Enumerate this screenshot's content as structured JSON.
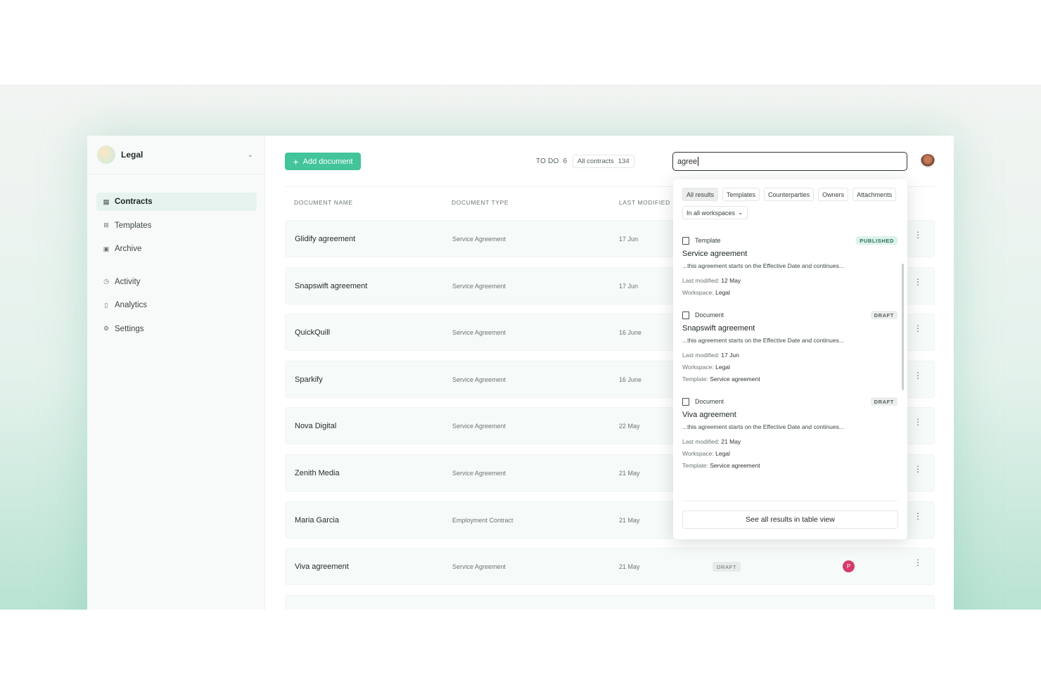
{
  "workspace": {
    "name": "Legal"
  },
  "nav": {
    "items": [
      {
        "label": "Contracts",
        "icon": "document-icon",
        "active": true
      },
      {
        "label": "Templates",
        "icon": "template-icon",
        "active": false
      },
      {
        "label": "Archive",
        "icon": "archive-icon",
        "active": false
      },
      {
        "label": "Activity",
        "icon": "clock-icon",
        "active": false
      },
      {
        "label": "Analytics",
        "icon": "chart-icon",
        "active": false
      },
      {
        "label": "Settings",
        "icon": "gear-icon",
        "active": false
      }
    ]
  },
  "toolbar": {
    "add_label": "Add document",
    "todo_label": "TO DO",
    "todo_count": "6",
    "all_label": "All contracts",
    "all_count": "134"
  },
  "search": {
    "value": "agree"
  },
  "table": {
    "headers": {
      "name": "DOCUMENT NAME",
      "type": "DOCUMENT TYPE",
      "modified": "LAST MODIFIED"
    },
    "rows": [
      {
        "name": "Glidify agreement",
        "type": "Service Agreement",
        "modified": "17 Jun"
      },
      {
        "name": "Snapswift agreement",
        "type": "Service Agreement",
        "modified": "17 Jun"
      },
      {
        "name": "QuickQuill",
        "type": "Service Agreement",
        "modified": "16 June"
      },
      {
        "name": "Sparkify",
        "type": "Service Agreement",
        "modified": "16 June"
      },
      {
        "name": "Nova Digital",
        "type": "Service Agreement",
        "modified": "22 May"
      },
      {
        "name": "Zenith Media",
        "type": "Service Agreement",
        "modified": "21 May"
      },
      {
        "name": "Maria Garcia",
        "type": "Employment Contract",
        "modified": "21 May"
      },
      {
        "name": "Viva agreement",
        "type": "Service Agreement",
        "modified": "21 May",
        "status": "DRAFT",
        "owner_initial": "P"
      }
    ]
  },
  "dropdown": {
    "filters": [
      "All results",
      "Templates",
      "Counterparties",
      "Owners",
      "Attachments"
    ],
    "workspace_select": "In all workspaces",
    "results": [
      {
        "kind": "Template",
        "badge": "PUBLISHED",
        "title": "Service agreement",
        "snippet": "...this agreement starts on the Effective Date and continues...",
        "modified_label": "Last modified:",
        "modified": "12 May",
        "workspace_label": "Workspace:",
        "workspace": "Legal"
      },
      {
        "kind": "Document",
        "badge": "DRAFT",
        "title": "Snapswift agreement",
        "snippet": "...this agreement starts on the Effective Date and continues...",
        "modified_label": "Last modified:",
        "modified": "17 Jun",
        "workspace_label": "Workspace:",
        "workspace": "Legal",
        "template_label": "Template:",
        "template": "Service agreement"
      },
      {
        "kind": "Document",
        "badge": "DRAFT",
        "title": "Viva agreement",
        "snippet": "...this agreement starts on the Effective Date and continues...",
        "modified_label": "Last modified:",
        "modified": "21 May",
        "workspace_label": "Workspace:",
        "workspace": "Legal",
        "template_label": "Template:",
        "template": "Service agreement"
      }
    ],
    "see_all_label": "See all results in table view"
  }
}
